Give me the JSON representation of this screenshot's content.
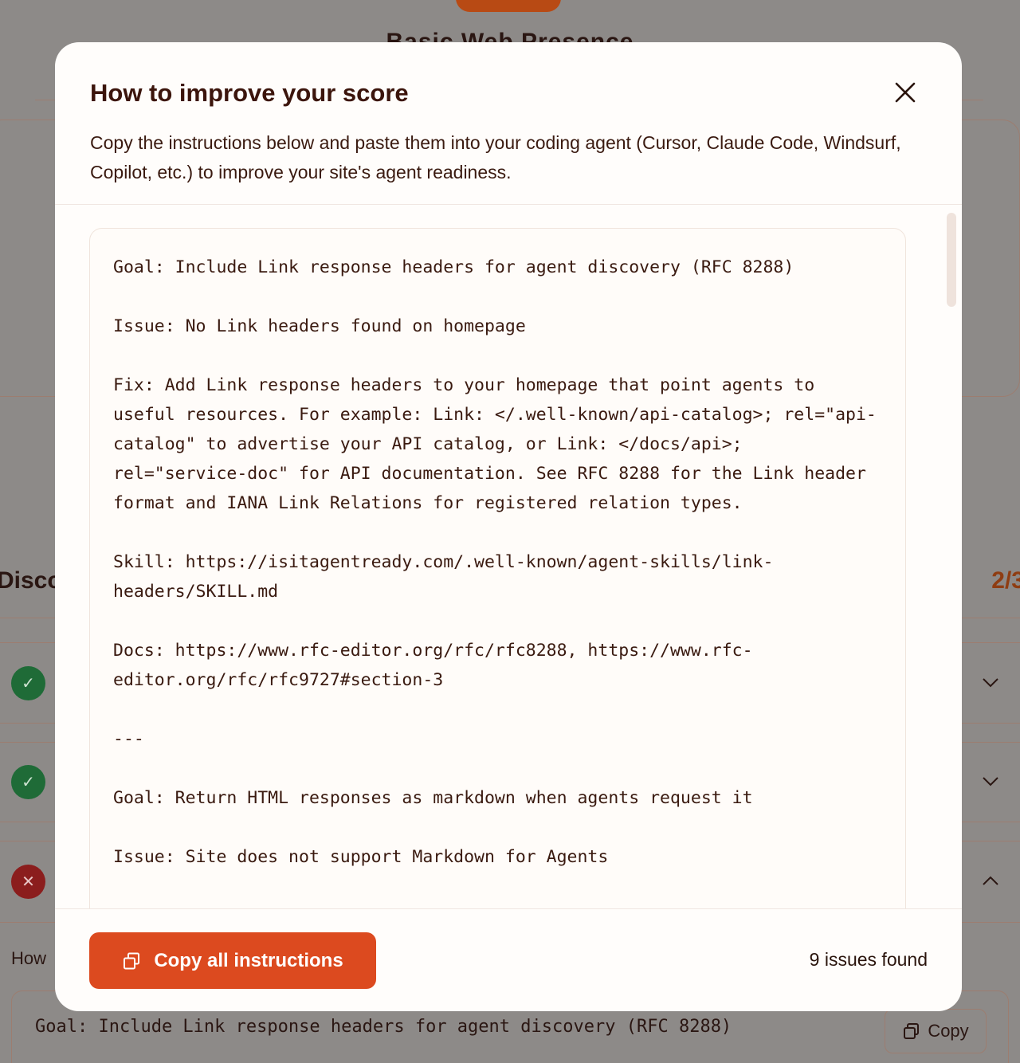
{
  "background": {
    "page_title": "Basic Web Presence",
    "section_title": "Disco",
    "section_count": "2/3",
    "how_label": "How",
    "code_line": "Goal: Include Link response headers for agent discovery (RFC 8288)",
    "copy_label": "Copy",
    "rows": [
      {
        "status": "pass",
        "icon": "check-icon",
        "expanded": false
      },
      {
        "status": "pass",
        "icon": "check-icon",
        "expanded": false
      },
      {
        "status": "fail",
        "icon": "x-icon",
        "expanded": true
      }
    ]
  },
  "modal": {
    "title": "How to improve your score",
    "description": "Copy the instructions below and paste them into your coding agent (Cursor, Claude Code, Windsurf, Copilot, etc.) to improve your site's agent readiness.",
    "instructions": "Goal: Include Link response headers for agent discovery (RFC 8288)\n\nIssue: No Link headers found on homepage\n\nFix: Add Link response headers to your homepage that point agents to useful resources. For example: Link: </.well-known/api-catalog>; rel=\"api-catalog\" to advertise your API catalog, or Link: </docs/api>; rel=\"service-doc\" for API documentation. See RFC 8288 for the Link header format and IANA Link Relations for registered relation types.\n\nSkill: https://isitagentready.com/.well-known/agent-skills/link-headers/SKILL.md\n\nDocs: https://www.rfc-editor.org/rfc/rfc8288, https://www.rfc-editor.org/rfc/rfc9727#section-3\n\n---\n\nGoal: Return HTML responses as markdown when agents request it\n\nIssue: Site does not support Markdown for Agents",
    "copy_all_label": "Copy all instructions",
    "issues_found": "9 issues found"
  },
  "colors": {
    "accent": "#dc4a1f",
    "title": "#3c150c",
    "pass": "#1f6b37",
    "fail": "#8b1d1d",
    "overlay": "#8d8a88"
  }
}
